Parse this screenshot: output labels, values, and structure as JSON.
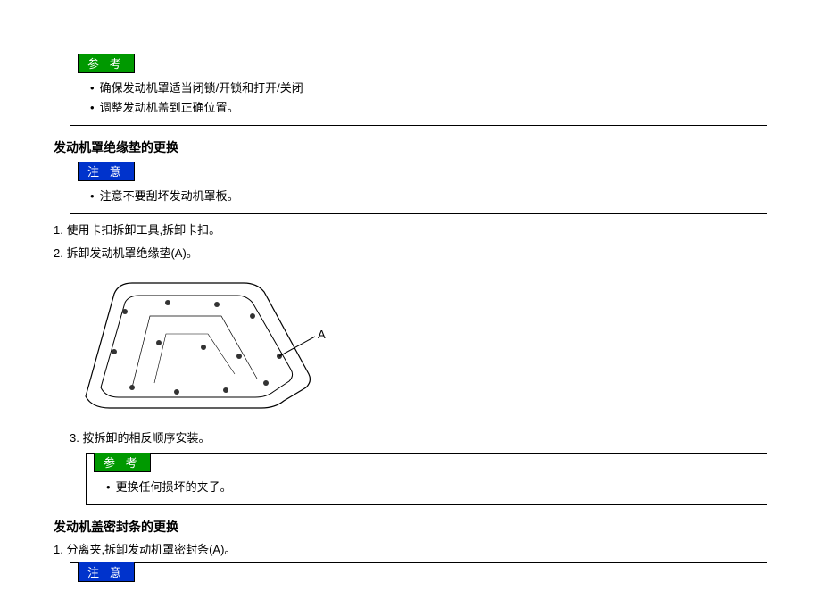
{
  "box1": {
    "header": "参 考",
    "items": [
      "确保发动机罩适当闭锁/开锁和打开/关闭",
      "调整发动机盖到正确位置。"
    ]
  },
  "section1": {
    "title": "发动机罩绝缘垫的更换"
  },
  "box2": {
    "header": "注 意",
    "items": [
      "注意不要刮坏发动机罩板。"
    ]
  },
  "steps1": {
    "s1": "1. 使用卡扣拆卸工具,拆卸卡扣。",
    "s2": "2. 拆卸发动机罩绝缘垫(A)。",
    "s3": "3. 按拆卸的相反顺序安装。"
  },
  "diagram": {
    "label": "A"
  },
  "box3": {
    "header": "参 考",
    "items": [
      "更换任何损坏的夹子。"
    ]
  },
  "section2": {
    "title": "发动机盖密封条的更换"
  },
  "steps2": {
    "s1": "1. 分离夹,拆卸发动机罩密封条(A)。"
  },
  "box4": {
    "header": "注 意"
  }
}
